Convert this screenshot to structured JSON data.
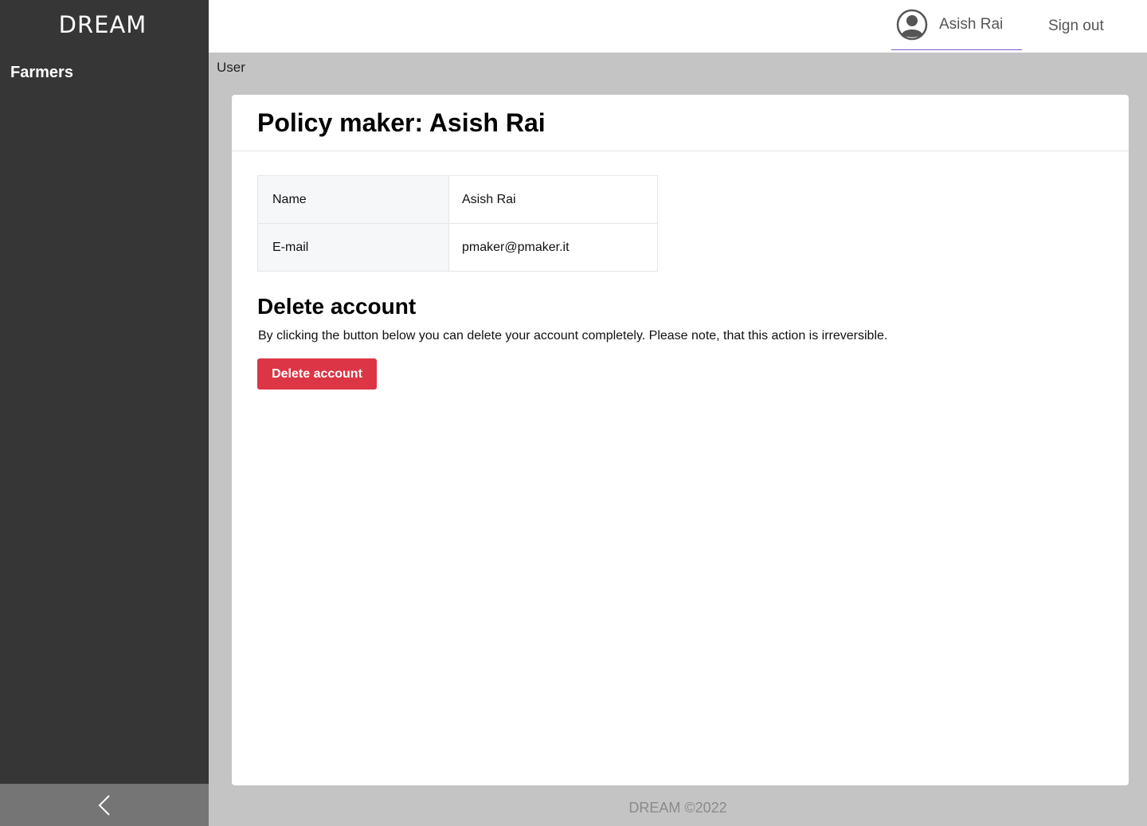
{
  "sidebar": {
    "brand": "DREAM",
    "items": [
      {
        "label": "Farmers",
        "icon": null
      }
    ],
    "collapse_icon": "chevron-left-icon"
  },
  "header": {
    "user_icon": "user-circle-icon",
    "user_name": "Asish Rai",
    "signout_label": "Sign out",
    "accent_color": "#7e57c2"
  },
  "breadcrumb": "User",
  "card": {
    "title": "Policy maker: Asish Rai",
    "details": [
      {
        "label": "Name",
        "value": "Asish Rai"
      },
      {
        "label": "E-mail",
        "value": "pmaker@pmaker.it"
      }
    ],
    "delete_section": {
      "title": "Delete account",
      "description": "By clicking the button below you can delete your account completely. Please note, that this action is irreversible.",
      "button_label": "Delete account",
      "button_color": "#dc3545"
    }
  },
  "footer": "DREAM ©2022"
}
